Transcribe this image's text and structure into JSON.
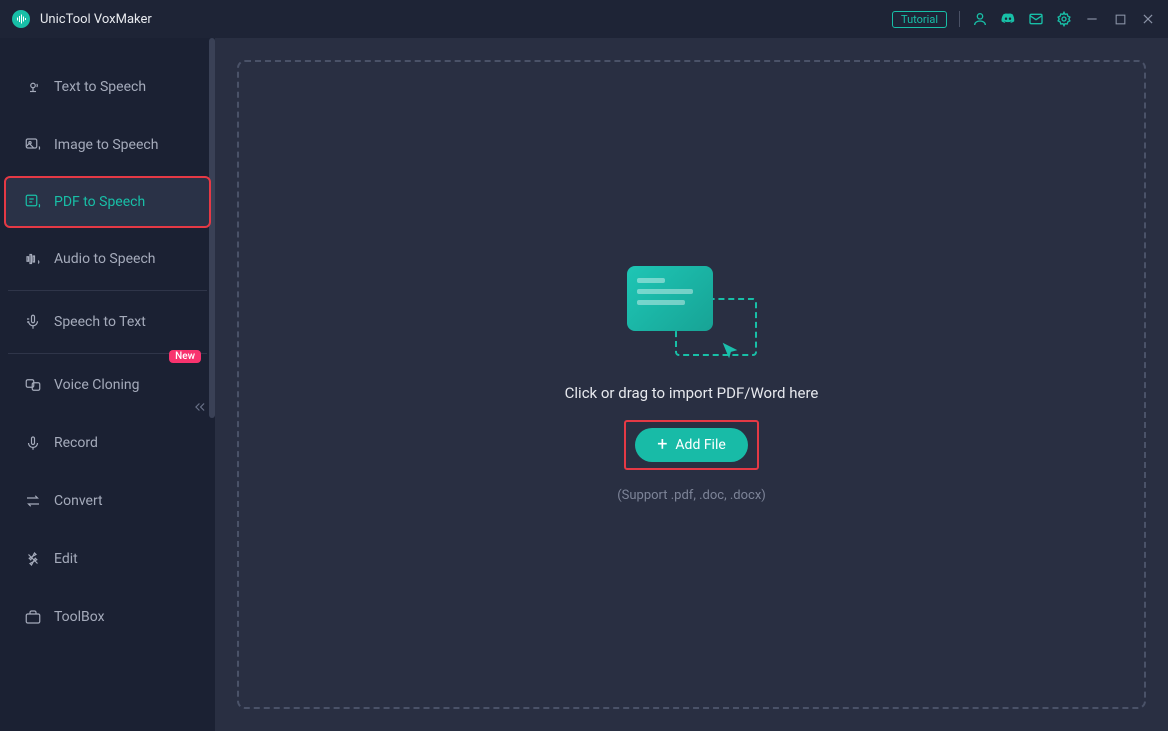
{
  "app": {
    "title": "UnicTool VoxMaker"
  },
  "header": {
    "tutorial_label": "Tutorial"
  },
  "sidebar": {
    "items": [
      {
        "label": "Text to Speech",
        "icon": "text-to-speech"
      },
      {
        "label": "Image to Speech",
        "icon": "image-to-speech"
      },
      {
        "label": "PDF to Speech",
        "icon": "pdf-to-speech",
        "active": true
      },
      {
        "label": "Audio to Speech",
        "icon": "audio-to-speech"
      },
      {
        "label": "Speech to Text",
        "icon": "speech-to-text"
      },
      {
        "label": "Voice Cloning",
        "icon": "voice-clone",
        "badge": "New"
      },
      {
        "label": "Record",
        "icon": "record"
      },
      {
        "label": "Convert",
        "icon": "convert"
      },
      {
        "label": "Edit",
        "icon": "edit"
      },
      {
        "label": "ToolBox",
        "icon": "toolbox"
      }
    ]
  },
  "main": {
    "drop_instruction": "Click or drag to import PDF/Word here",
    "add_file_label": "Add File",
    "support_text": "(Support .pdf, .doc, .docx)"
  },
  "colors": {
    "accent": "#18bfa7",
    "highlight": "#e53945",
    "badge": "#f8336e",
    "bg": "#292f42",
    "sidebar_bg": "#1b2133"
  }
}
